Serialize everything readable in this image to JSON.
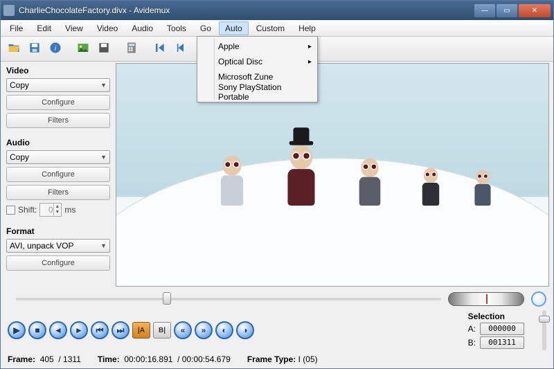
{
  "window": {
    "title": "CharlieChocolateFactory.divx - Avidemux"
  },
  "menu": {
    "items": [
      "File",
      "Edit",
      "View",
      "Video",
      "Audio",
      "Tools",
      "Go",
      "Auto",
      "Custom",
      "Help"
    ],
    "open_index": 7,
    "dropdown": {
      "items": [
        {
          "label": "Apple",
          "submenu": true
        },
        {
          "label": "Optical Disc",
          "submenu": true
        },
        {
          "label": "Microsoft Zune",
          "submenu": false
        },
        {
          "label": "Sony PlayStation Portable",
          "submenu": false
        }
      ]
    }
  },
  "toolbar_icons": [
    "open",
    "save",
    "info",
    "picture",
    "save-image",
    "calculator",
    "first",
    "prev",
    "play",
    "next",
    "last"
  ],
  "sidebar": {
    "video": {
      "label": "Video",
      "codec": "Copy",
      "configure": "Configure",
      "filters": "Filters"
    },
    "audio": {
      "label": "Audio",
      "codec": "Copy",
      "configure": "Configure",
      "filters": "Filters",
      "shift_label": "Shift:",
      "shift_value": "0",
      "shift_unit": "ms"
    },
    "format": {
      "label": "Format",
      "container": "AVI, unpack VOP",
      "configure": "Configure"
    }
  },
  "selection": {
    "label": "Selection",
    "a_label": "A:",
    "a": "000000",
    "b_label": "B:",
    "b": "001311"
  },
  "status": {
    "frame_label": "Frame:",
    "frame": "405",
    "frame_total": "/ 1311",
    "time_label": "Time:",
    "time": "00:00:16.891",
    "time_total": "/ 00:00:54.679",
    "type_label": "Frame Type:",
    "type": "I (05)"
  },
  "people": [
    {
      "left": "24%",
      "scale": 0.95,
      "body": "#c9cfd9",
      "hat": false
    },
    {
      "left": "40%",
      "scale": 1.15,
      "body": "#5a2026",
      "hat": true
    },
    {
      "left": "56%",
      "scale": 0.9,
      "body": "#5a5e68",
      "hat": false
    },
    {
      "left": "70%",
      "scale": 0.72,
      "body": "#2d2f36",
      "hat": false
    },
    {
      "left": "82%",
      "scale": 0.68,
      "body": "#4a5766",
      "hat": false
    }
  ]
}
